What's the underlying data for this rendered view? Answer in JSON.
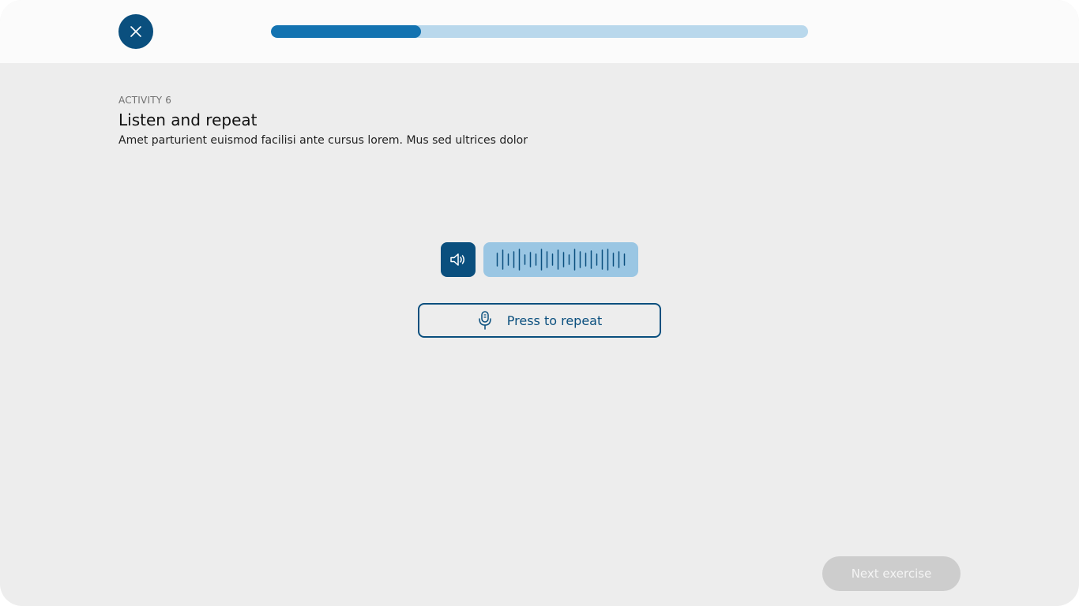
{
  "header": {
    "close_icon": "close-icon",
    "progress": 0.28,
    "colors": {
      "accent": "#0a4f7e",
      "progress_fill": "#1373b1",
      "progress_track": "#b9d8ec"
    }
  },
  "activity": {
    "label": "ACTIVITY 6",
    "title": "Listen and repeat",
    "description": "Amet parturient euismod facilisi ante cursus lorem. Mus sed ultrices dolor"
  },
  "audio": {
    "play_icon": "speaker-icon",
    "waveform_bars": [
      16,
      24,
      14,
      20,
      26,
      12,
      18,
      14,
      26,
      20,
      14,
      24,
      18,
      12,
      26,
      20,
      16,
      22,
      14,
      24,
      26,
      16,
      20,
      14
    ]
  },
  "record": {
    "icon": "microphone-icon",
    "label": "Press to repeat"
  },
  "footer": {
    "next_label": "Next exercise"
  }
}
